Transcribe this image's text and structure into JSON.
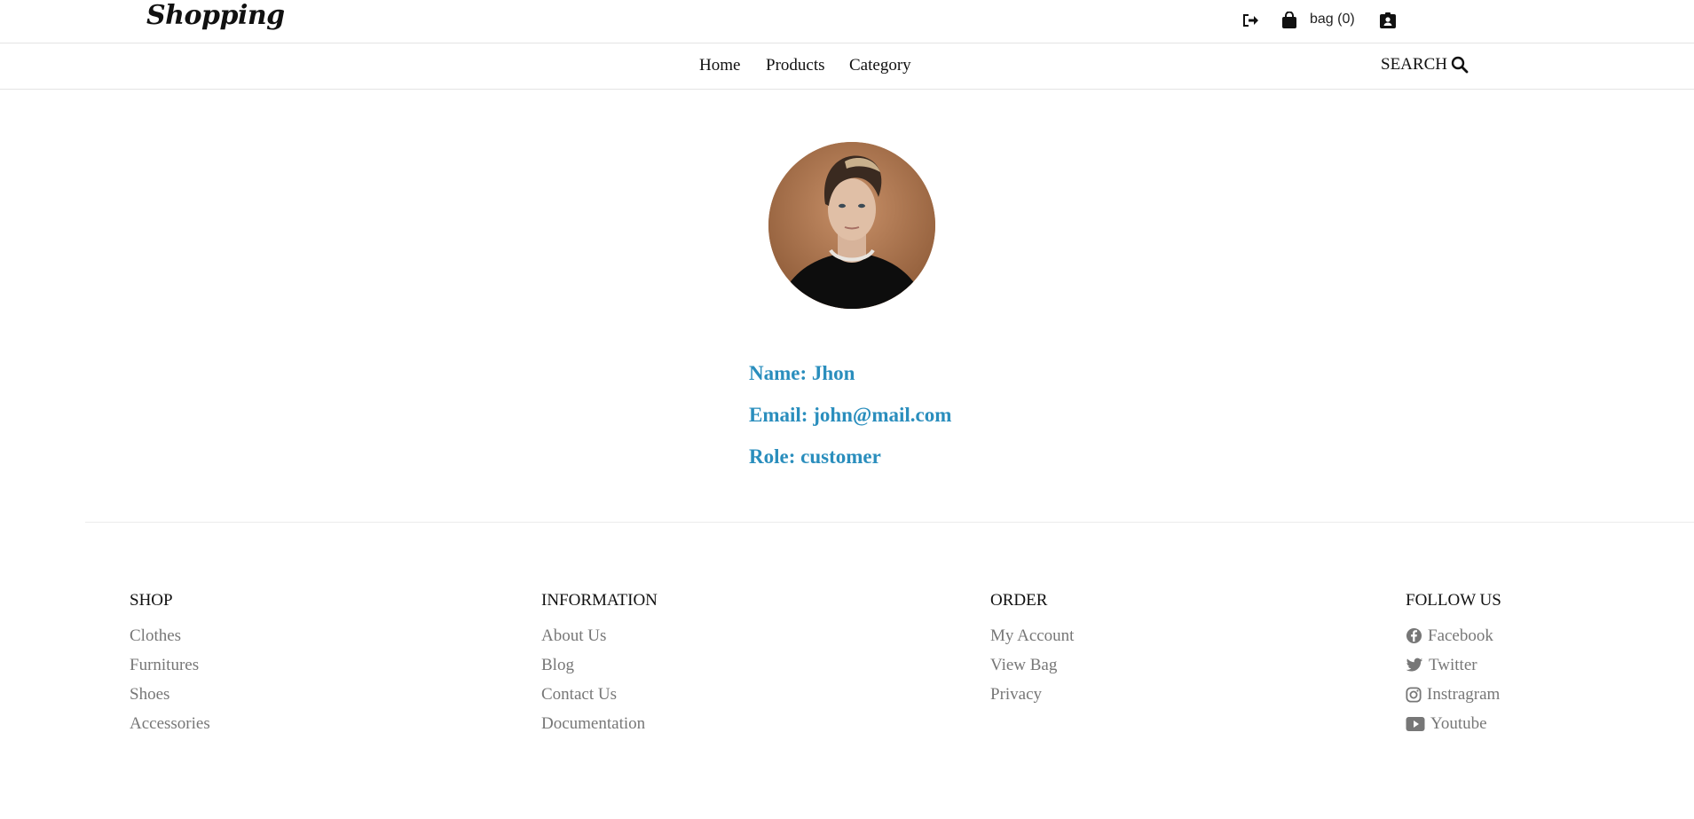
{
  "header": {
    "logo": "Shopping",
    "bag_label": "bag (0)",
    "icons": [
      "sign-out-icon",
      "shopping-bag-icon",
      "id-badge-icon"
    ]
  },
  "nav": {
    "links": [
      "Home",
      "Products",
      "Category"
    ],
    "search_label": "SEARCH"
  },
  "profile": {
    "name": "Name: Jhon",
    "email": "Email: john@mail.com",
    "role": "Role: customer"
  },
  "footer": {
    "shop": {
      "title": "SHOP",
      "links": [
        "Clothes",
        "Furnitures",
        "Shoes",
        "Accessories"
      ]
    },
    "information": {
      "title": "INFORMATION",
      "links": [
        "About Us",
        "Blog",
        "Contact Us",
        "Documentation"
      ]
    },
    "order": {
      "title": "ORDER",
      "links": [
        "My Account",
        "View Bag",
        "Privacy"
      ]
    },
    "follow": {
      "title": "FOLLOW US",
      "links": [
        "Facebook",
        "Twitter",
        "Instragram",
        "Youtube"
      ]
    }
  },
  "colors": {
    "accent": "#2a8ebd",
    "footer_link": "#777777"
  }
}
